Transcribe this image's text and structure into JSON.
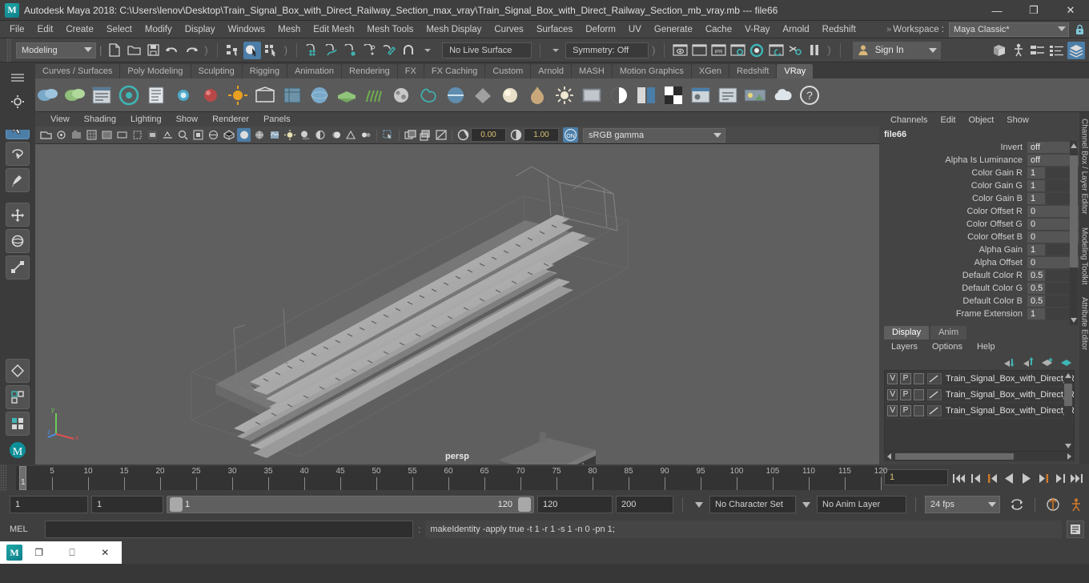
{
  "titlebar": {
    "app_title": "Autodesk Maya 2018: C:\\Users\\lenov\\Desktop\\Train_Signal_Box_with_Direct_Railway_Section_max_vray\\Train_Signal_Box_with_Direct_Railway_Section_mb_vray.mb  ---  file66",
    "logo": "M",
    "minimize": "—",
    "maximize": "❐",
    "close": "✕"
  },
  "menubar": {
    "items": [
      "File",
      "Edit",
      "Create",
      "Select",
      "Modify",
      "Display",
      "Windows",
      "Mesh",
      "Edit Mesh",
      "Mesh Tools",
      "Mesh Display",
      "Curves",
      "Surfaces",
      "Deform",
      "UV",
      "Generate",
      "Cache",
      "V-Ray",
      "Arnold",
      "Redshift"
    ],
    "workspace_label": "Workspace :",
    "workspace_value": "Maya Classic*",
    "overflow_chevron": "»"
  },
  "statusbar": {
    "mode_value": "Modeling",
    "live_surface": "No Live Surface",
    "symmetry": "Symmetry: Off",
    "sign_in": "Sign In",
    "icons_left": [
      "new-scene-icon",
      "open-scene-icon",
      "save-scene-icon",
      "undo-icon",
      "redo-icon"
    ],
    "select_modes": [
      "select-hierarchy-icon",
      "select-object-icon",
      "select-component-icon"
    ],
    "snap_icons": [
      "snap-grid-icon",
      "snap-curve-icon",
      "snap-point-icon",
      "snap-projected-icon",
      "snap-view-plane-icon",
      "magnet-icon"
    ],
    "render_icons": [
      "render-view-icon",
      "render-frame-icon",
      "ipr-icon",
      "render-settings-icon",
      "hypershade-icon",
      "render-sequence-icon",
      "render-setup-icon",
      "pause-render-icon"
    ],
    "editor_icons": [
      "outliner-icon",
      "rigging-editor-icon",
      "attribute-editor-icon",
      "channel-box-icon",
      "layers-icon"
    ]
  },
  "shelf": {
    "tabs": [
      "Curves / Surfaces",
      "Poly Modeling",
      "Sculpting",
      "Rigging",
      "Animation",
      "Rendering",
      "FX",
      "FX Caching",
      "Custom",
      "Arnold",
      "MASH",
      "Motion Graphics",
      "XGen",
      "Redshift",
      "VRay"
    ],
    "selected_tab": "VRay"
  },
  "viewport": {
    "menus": [
      "View",
      "Shading",
      "Lighting",
      "Show",
      "Renderer",
      "Panels"
    ],
    "exposure_value": "0.00",
    "gamma_value": "1.00",
    "color_management": "sRGB gamma",
    "cm_toggle": "ON",
    "camera_label": "persp",
    "axis_labels": {
      "y": "y",
      "z": "z",
      "x": "x"
    }
  },
  "channelbox": {
    "menus": [
      "Channels",
      "Edit",
      "Object",
      "Show"
    ],
    "node_name": "file66",
    "attributes": [
      {
        "label": "Invert",
        "value": "off",
        "type": "enum"
      },
      {
        "label": "Alpha Is Luminance",
        "value": "off",
        "type": "enum"
      },
      {
        "label": "Color Gain R",
        "value": "1",
        "type": "num"
      },
      {
        "label": "Color Gain G",
        "value": "1",
        "type": "num"
      },
      {
        "label": "Color Gain B",
        "value": "1",
        "type": "num"
      },
      {
        "label": "Color Offset R",
        "value": "0",
        "type": "num"
      },
      {
        "label": "Color Offset G",
        "value": "0",
        "type": "num"
      },
      {
        "label": "Color Offset B",
        "value": "0",
        "type": "num"
      },
      {
        "label": "Alpha Gain",
        "value": "1",
        "type": "num"
      },
      {
        "label": "Alpha Offset",
        "value": "0",
        "type": "num"
      },
      {
        "label": "Default Color R",
        "value": "0.5",
        "type": "num"
      },
      {
        "label": "Default Color G",
        "value": "0.5",
        "type": "num"
      },
      {
        "label": "Default Color B",
        "value": "0.5",
        "type": "num"
      },
      {
        "label": "Frame Extension",
        "value": "1",
        "type": "num"
      }
    ]
  },
  "layereditor": {
    "tabs": [
      "Display",
      "Anim"
    ],
    "selected_tab": "Display",
    "menus": [
      "Layers",
      "Options",
      "Help"
    ],
    "buttons": [
      "move-layer-up-icon",
      "move-layer-down-icon",
      "new-layer-icon",
      "new-layer-from-selected-icon"
    ],
    "layers": [
      {
        "visibility": "V",
        "playback": "P",
        "lock": "",
        "name": "Train_Signal_Box_with_Direct_Rai"
      },
      {
        "visibility": "V",
        "playback": "P",
        "lock": "",
        "name": "Train_Signal_Box_with_Direct_Rai"
      },
      {
        "visibility": "V",
        "playback": "P",
        "lock": "",
        "name": "Train_Signal_Box_with_Direct_Rai"
      }
    ]
  },
  "sidebar_tabs": [
    "Channel Box / Layer Editor",
    "Modeling Toolkit",
    "Attribute Editor"
  ],
  "timeline": {
    "ticks": [
      5,
      10,
      15,
      20,
      25,
      30,
      35,
      40,
      45,
      50,
      55,
      60,
      65,
      70,
      75,
      80,
      85,
      90,
      95,
      100,
      105,
      110,
      115,
      120
    ],
    "start": 1,
    "end": 120,
    "current_frame": "1",
    "cursor_label": "1",
    "playback_buttons": [
      "go-to-start-icon",
      "step-back-keyframe-icon",
      "step-back-frame-icon",
      "play-backwards-icon",
      "play-forwards-icon",
      "step-forward-frame-icon",
      "step-forward-keyframe-icon",
      "go-to-end-icon"
    ]
  },
  "rangeslider": {
    "anim_start": "1",
    "range_start": "1",
    "bar_start": "1",
    "bar_end": "120",
    "range_end": "120",
    "anim_end": "200",
    "character_set": "No Character Set",
    "anim_layer": "No Anim Layer",
    "fps": "24 fps",
    "icons": [
      "auto-key-icon",
      "animation-preferences-icon",
      "loop-playback-icon"
    ]
  },
  "melbar": {
    "label": "MEL",
    "input_value": "",
    "output_text": "makeIdentity -apply true -t 1 -r 1 -s 1 -n 0 -pn 1;",
    "script_editor_icon": "script-editor-icon"
  },
  "taskbar": {
    "app_icon": "M",
    "restore": "❐",
    "minimize": "⎕",
    "close": "✕"
  },
  "colors": {
    "accent_blue": "#4c7ea8",
    "maya_teal": "#0d9a9a",
    "field_yellow": "#d8c070",
    "panel_bg": "#444444",
    "window_bg": "#373737",
    "viewport_bg": "#5f5f5f",
    "orange": "#d07828"
  }
}
